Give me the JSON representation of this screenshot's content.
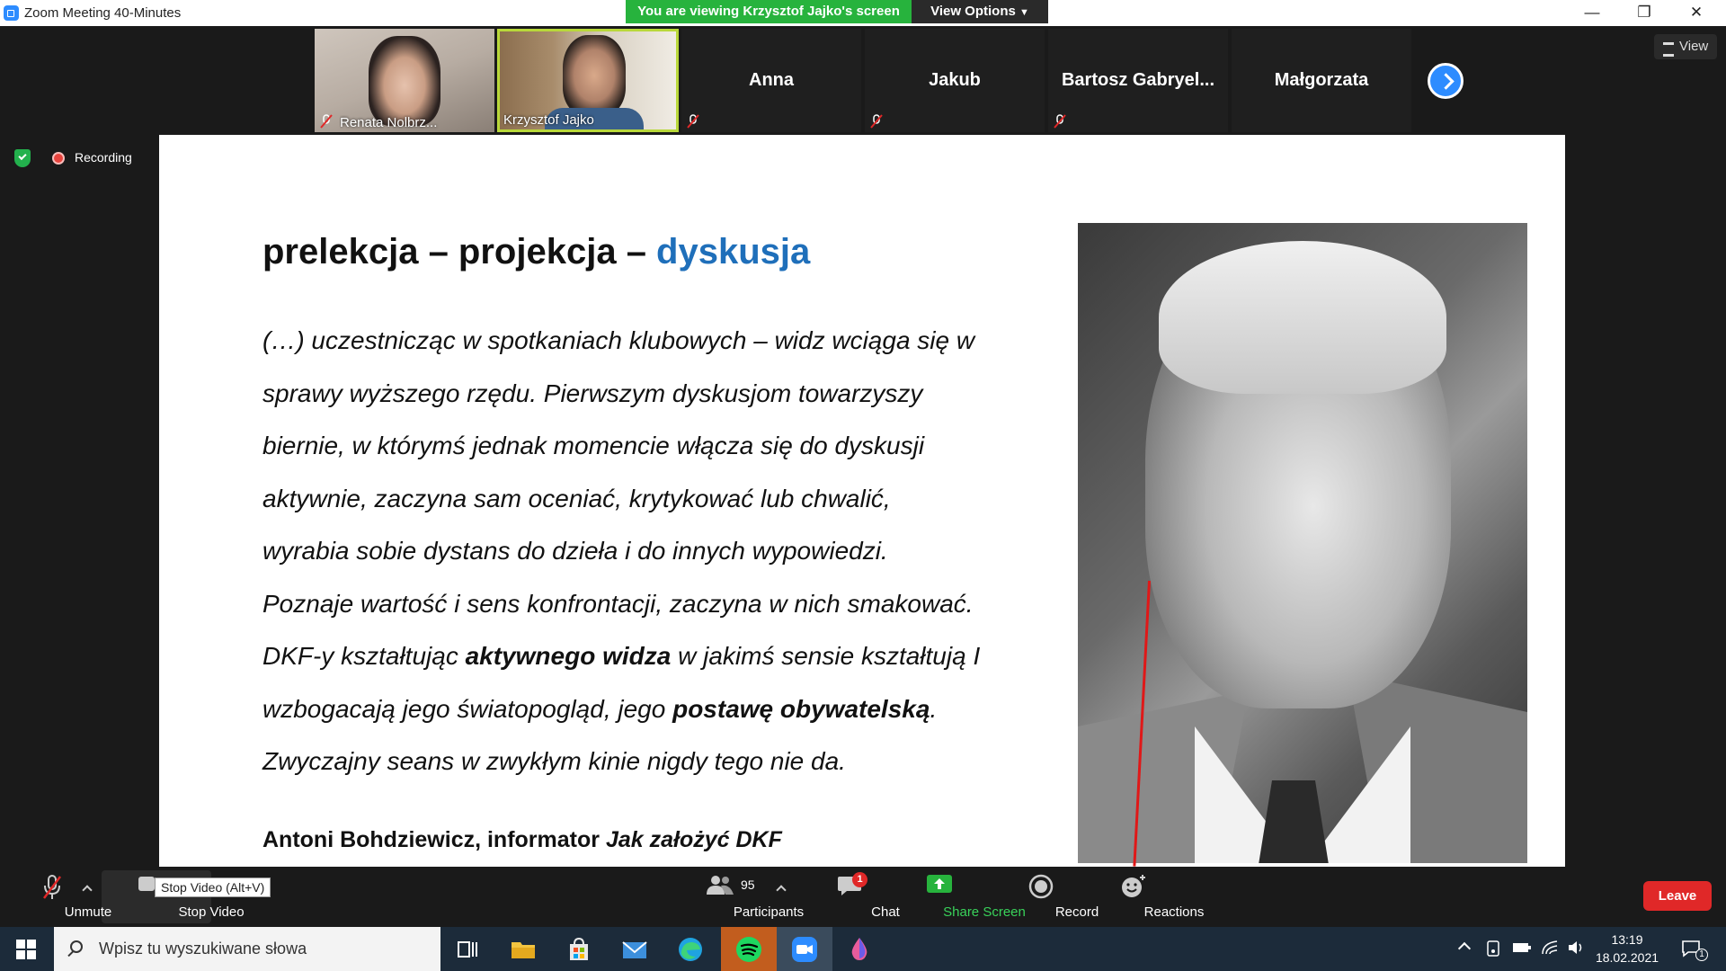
{
  "window": {
    "title": "Zoom Meeting 40-Minutes",
    "share_banner": "You are viewing Krzysztof Jajko's screen",
    "view_options": "View Options",
    "minimize": "—",
    "restore": "❐",
    "close": "✕"
  },
  "participants": {
    "tiles": [
      {
        "name": "Renata Nolbrz...",
        "type": "video",
        "muted": true
      },
      {
        "name": "Krzysztof Jajko",
        "type": "video",
        "muted": false,
        "active": true
      },
      {
        "name": "Anna",
        "type": "name",
        "muted": true
      },
      {
        "name": "Jakub",
        "type": "name",
        "muted": true
      },
      {
        "name": "Bartosz  Gabryel...",
        "type": "name",
        "muted": true
      },
      {
        "name": "Małgorzata",
        "type": "name",
        "muted": false
      }
    ],
    "view_label": "View"
  },
  "status": {
    "recording_label": "Recording"
  },
  "slide": {
    "title_part1": "prelekcja – projekcja – ",
    "title_accent": "dyskusja",
    "quote_lines": [
      "(…) uczestnicząc w spotkaniach klubowych – widz wciąga się w",
      "sprawy wyższego rzędu. Pierwszym dyskusjom towarzyszy",
      "biernie, w którymś jednak momencie włącza się do dyskusji",
      "aktywnie, zaczyna sam oceniać, krytykować lub chwalić,",
      "wyrabia sobie dystans do dzieła i do innych wypowiedzi.",
      "Poznaje wartość i sens konfrontacji, zaczyna w nich smakować."
    ],
    "line7_a": "DKF-y kształtując ",
    "line7_b": "aktywnego widza",
    "line7_c": " w jakimś sensie kształtują I",
    "line8_a": "wzbogacają jego światopogląd, jego ",
    "line8_b": "postawę obywatelską",
    "line8_c": ".",
    "line9": "Zwyczajny seans w zwykłym kinie nigdy tego nie da.",
    "source_a": "Antoni Bohdziewicz, informator ",
    "source_b": "Jak założyć DKF"
  },
  "toolbar": {
    "unmute": "Unmute",
    "stop_video": "Stop Video",
    "tooltip": "Stop Video (Alt+V)",
    "participants_count": "95",
    "participants": "Participants",
    "chat": "Chat",
    "chat_badge": "1",
    "share_screen": "Share Screen",
    "record": "Record",
    "reactions": "Reactions",
    "leave": "Leave"
  },
  "taskbar": {
    "search_placeholder": "Wpisz tu wyszukiwane słowa",
    "time": "13:19",
    "date": "18.02.2021",
    "notifications_count": "1"
  },
  "colors": {
    "accent_blue": "#1f6fba",
    "zoom_blue": "#2d8cff",
    "banner_green": "#27b33d",
    "leave_red": "#e02828"
  }
}
